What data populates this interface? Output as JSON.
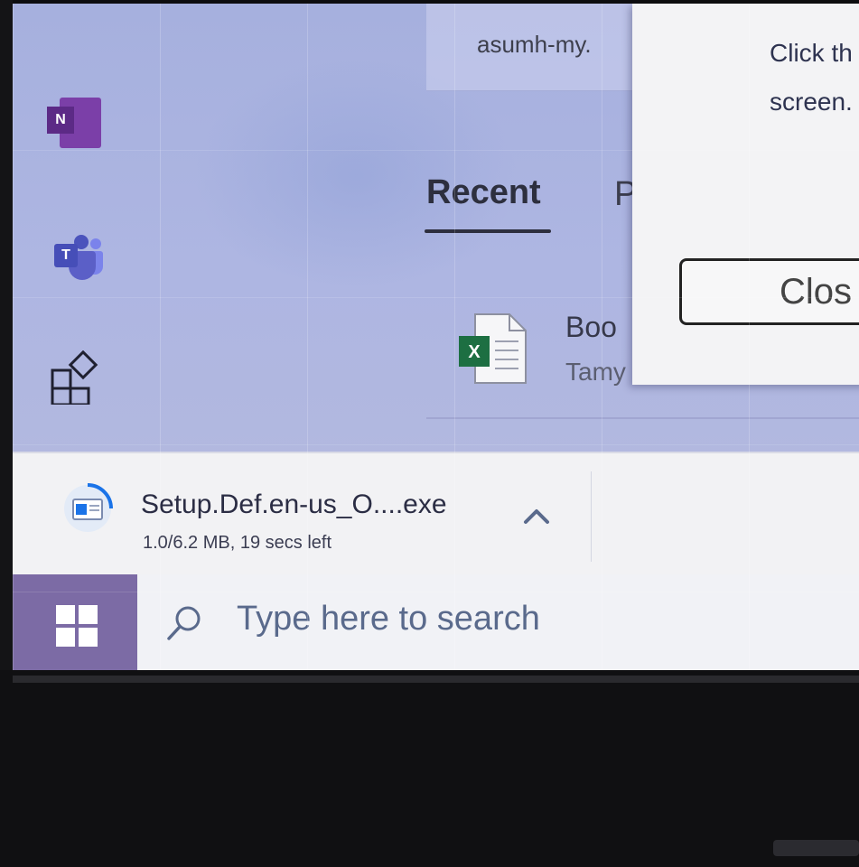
{
  "browser": {
    "address_text": "asumh-my."
  },
  "tabs": {
    "recent_label": "Recent",
    "next_label_partial": "P"
  },
  "recent_file": {
    "title_partial": "Boo",
    "subtitle_partial": "Tamy",
    "icon": "excel-file-icon"
  },
  "dialog": {
    "message_line1": "Click th",
    "message_line2": "screen.",
    "close_label": "Clos"
  },
  "download": {
    "filename": "Setup.Def.en-us_O....exe",
    "status": "1.0/6.2 MB, 19 secs left",
    "icon": "installer-download-icon"
  },
  "taskbar": {
    "search_placeholder": "Type here to search",
    "start_icon": "windows-logo-icon"
  },
  "rail": {
    "items": [
      "onenote-icon",
      "teams-icon",
      "apps-icon"
    ]
  },
  "colors": {
    "accent_start": "#7c6ba5",
    "background": "#aeb6e2",
    "excel_green": "#1d6f42"
  }
}
